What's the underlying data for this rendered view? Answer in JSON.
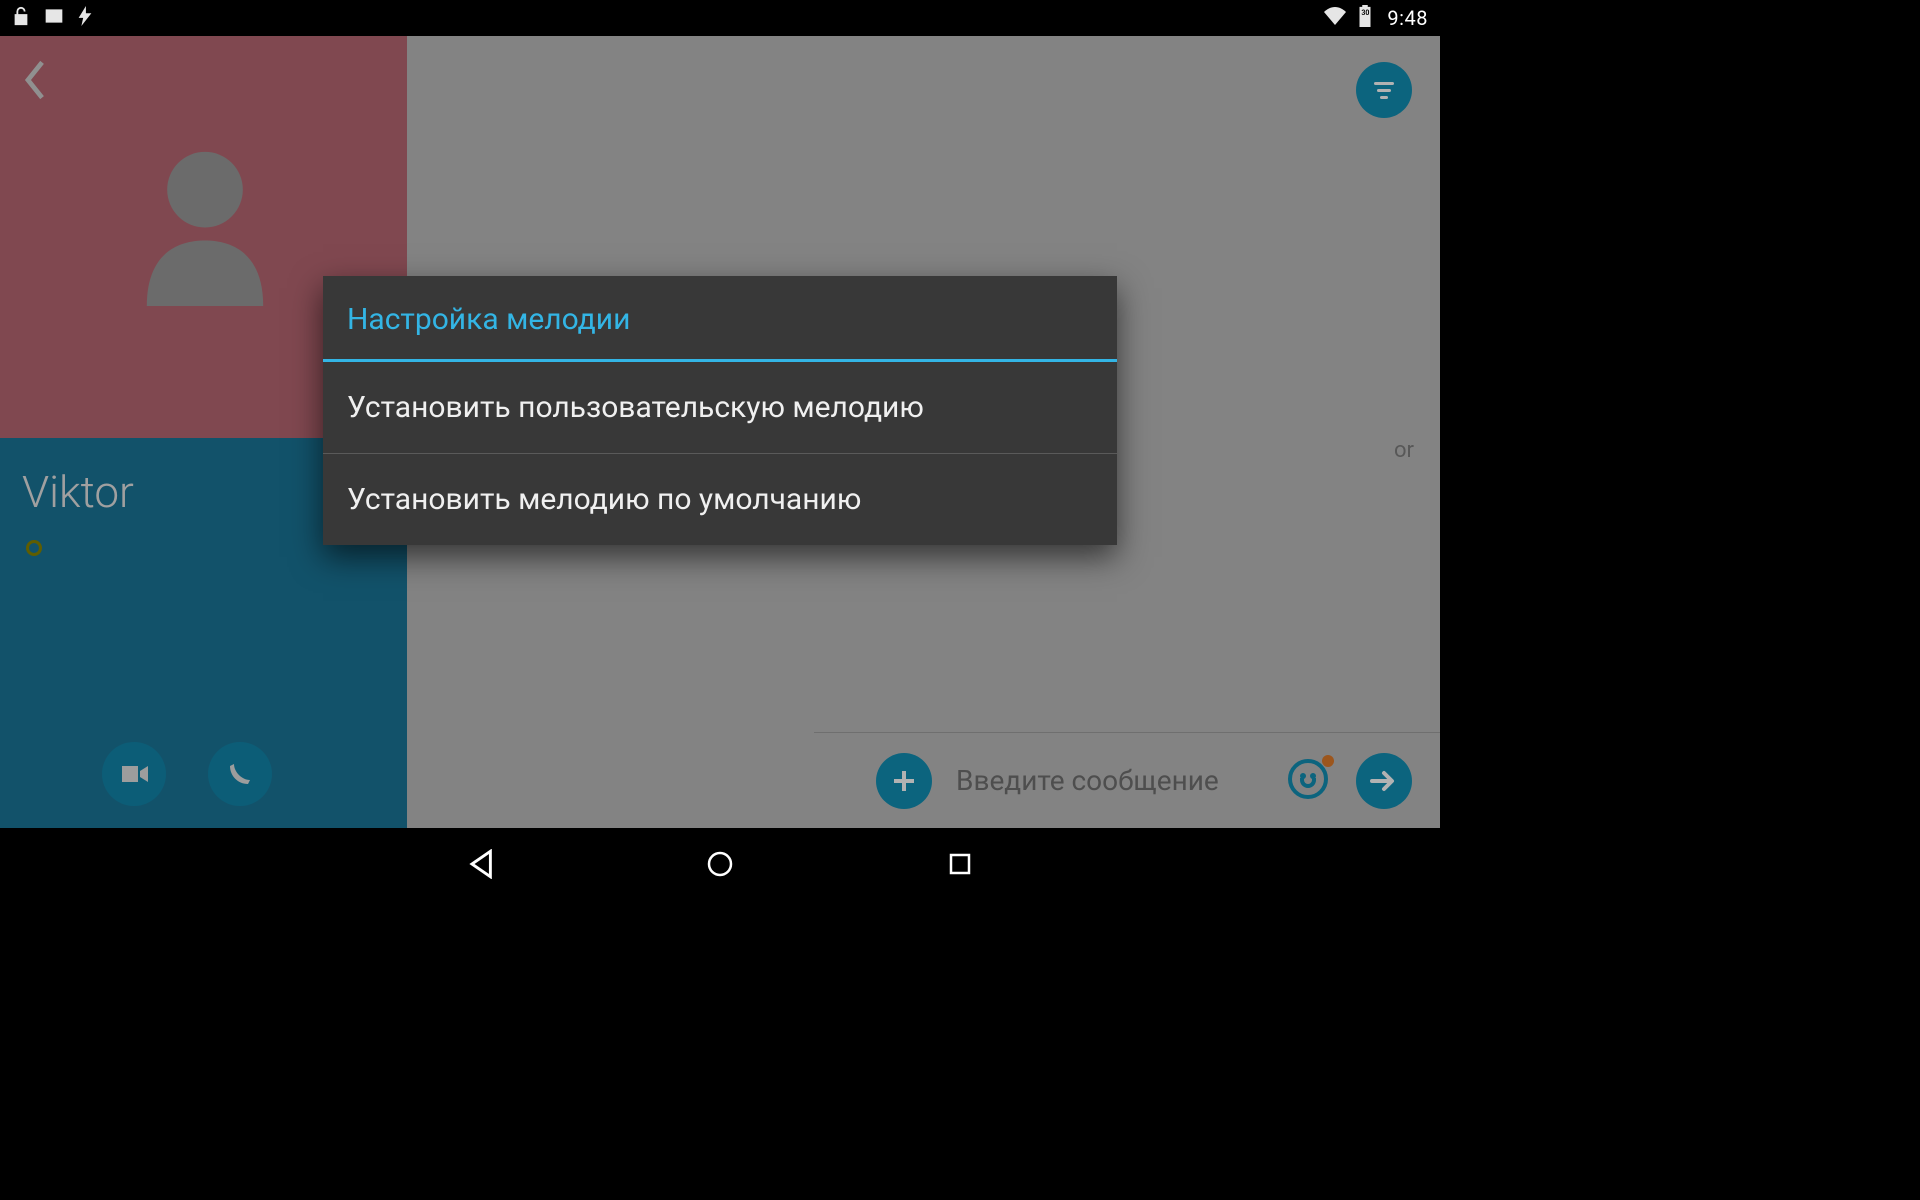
{
  "status_bar": {
    "clock": "9:48",
    "battery_label": "30"
  },
  "contact": {
    "name": "Viktor"
  },
  "chat": {
    "background_hint_suffix": "or",
    "input_placeholder": "Введите сообщение"
  },
  "dialog": {
    "title": "Настройка мелодии",
    "options": [
      "Установить пользовательскую мелодию",
      "Установить мелодию по умолчанию"
    ]
  }
}
